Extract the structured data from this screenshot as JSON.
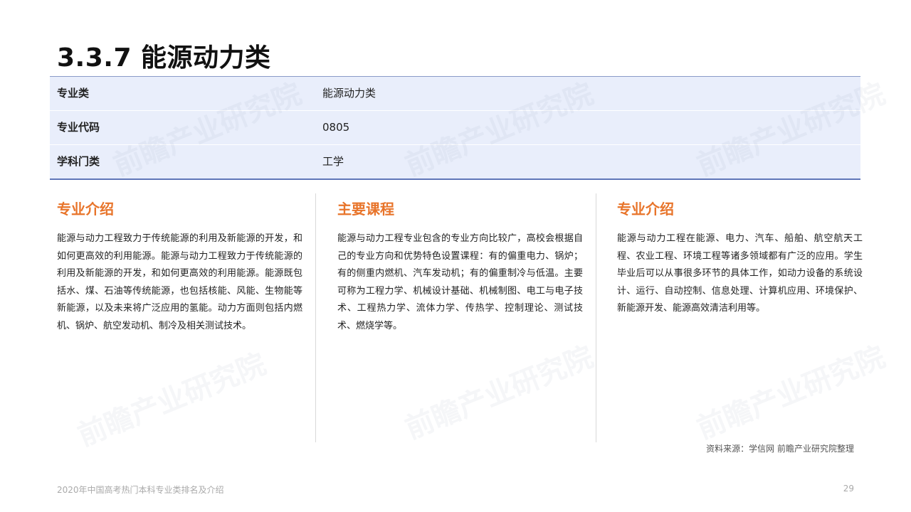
{
  "title": "3.3.7 能源动力类",
  "info_table": [
    {
      "label": "专业类",
      "value": "能源动力类"
    },
    {
      "label": "专业代码",
      "value": "0805"
    },
    {
      "label": "学科门类",
      "value": "工学"
    }
  ],
  "columns": [
    {
      "heading": "专业介绍",
      "text": "能源与动力工程致力于传统能源的利用及新能源的开发，和如何更高效的利用能源。能源与动力工程致力于传统能源的利用及新能源的开发，和如何更高效的利用能源。能源既包括水、煤、石油等传统能源，也包括核能、风能、生物能等新能源，以及未来将广泛应用的氢能。动力方面则包括内燃机、锅炉、航空发动机、制冷及相关测试技术。"
    },
    {
      "heading": "主要课程",
      "text": "能源与动力工程专业包含的专业方向比较广，高校会根据自己的专业方向和优势特色设置课程：有的偏重电力、锅炉；有的侧重内燃机、汽车发动机；有的偏重制冷与低温。主要可称为工程力学、机械设计基础、机械制图、电工与电子技术、工程热力学、流体力学、传热学、控制理论、测试技术、燃烧学等。"
    },
    {
      "heading": "专业介绍",
      "text": "能源与动力工程在能源、电力、汽车、船舶、航空航天工程、农业工程、环境工程等诸多领域都有广泛的应用。学生毕业后可以从事很多环节的具体工作，如动力设备的系统设计、运行、自动控制、信息处理、计算机应用、环境保护、新能源开发、能源高效清洁利用等。"
    }
  ],
  "source": "资料来源：学信网 前瞻产业研究院整理",
  "footer": {
    "left": "2020年中国高考热门本科专业类排名及介绍",
    "page_number": "29"
  },
  "watermark": "前瞻产业研究院"
}
